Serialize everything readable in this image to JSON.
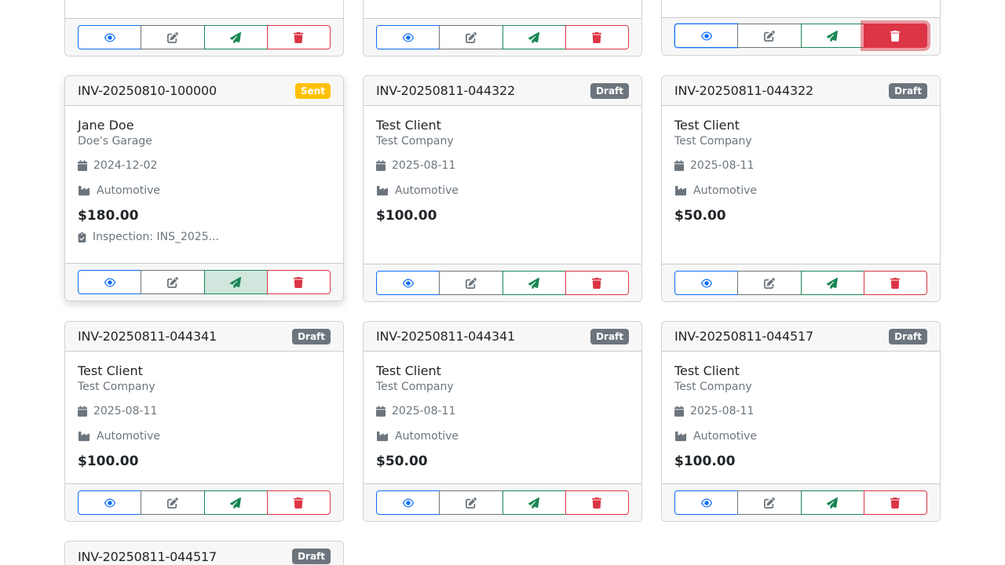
{
  "colors": {
    "primary": "#0d6efd",
    "secondary": "#6c757d",
    "success": "#198754",
    "danger": "#dc3545",
    "warning": "#ffc107"
  },
  "action_icons": [
    "eye-icon",
    "edit-icon",
    "paper-plane-icon",
    "trash-icon"
  ],
  "meta_icons": [
    "calendar-icon",
    "industry-icon",
    "clipboard-check-icon"
  ],
  "cards": [
    {
      "invoice": "INV-20250810-100000",
      "status": "Sent",
      "client": "Jane Doe",
      "company": "Doe's Garage",
      "date": "2024-12-02",
      "industry": "Automotive",
      "amount": "$180.00",
      "inspection": "Inspection: INS_2025..."
    },
    {
      "invoice": "INV-20250811-044322",
      "status": "Draft",
      "client": "Test Client",
      "company": "Test Company",
      "date": "2025-08-11",
      "industry": "Automotive",
      "amount": "$100.00"
    },
    {
      "invoice": "INV-20250811-044322",
      "status": "Draft",
      "client": "Test Client",
      "company": "Test Company",
      "date": "2025-08-11",
      "industry": "Automotive",
      "amount": "$50.00"
    },
    {
      "invoice": "INV-20250811-044341",
      "status": "Draft",
      "client": "Test Client",
      "company": "Test Company",
      "date": "2025-08-11",
      "industry": "Automotive",
      "amount": "$100.00"
    },
    {
      "invoice": "INV-20250811-044341",
      "status": "Draft",
      "client": "Test Client",
      "company": "Test Company",
      "date": "2025-08-11",
      "industry": "Automotive",
      "amount": "$50.00"
    },
    {
      "invoice": "INV-20250811-044517",
      "status": "Draft",
      "client": "Test Client",
      "company": "Test Company",
      "date": "2025-08-11",
      "industry": "Automotive",
      "amount": "$100.00"
    },
    {
      "invoice": "INV-20250811-044517",
      "status": "Draft"
    }
  ]
}
